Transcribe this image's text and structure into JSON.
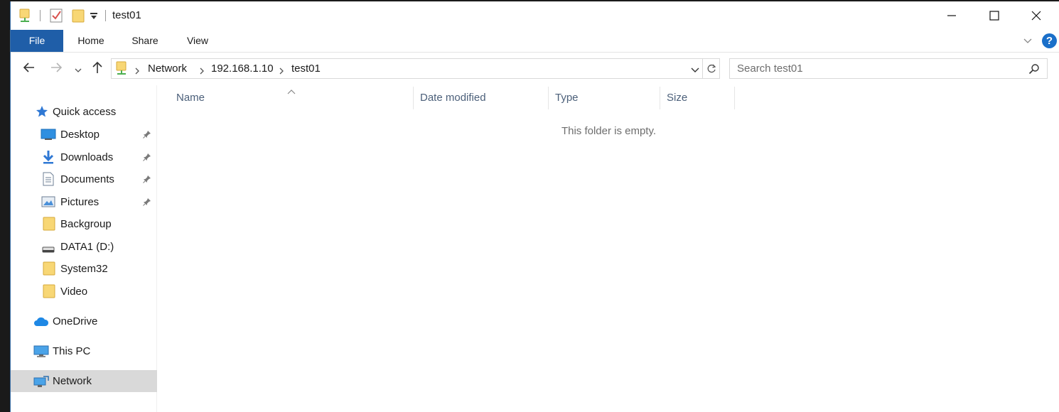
{
  "window": {
    "title": "test01"
  },
  "ribbon": {
    "tabs": [
      "File",
      "Home",
      "Share",
      "View"
    ],
    "help_label": "?"
  },
  "address_bar": {
    "crumbs": [
      "Network",
      "192.168.1.10",
      "test01"
    ]
  },
  "search": {
    "placeholder": "Search test01"
  },
  "sidebar": {
    "quick_access": "Quick access",
    "items": [
      {
        "label": "Desktop",
        "icon": "desktop-icon",
        "pinned": true
      },
      {
        "label": "Downloads",
        "icon": "downloads-icon",
        "pinned": true
      },
      {
        "label": "Documents",
        "icon": "documents-icon",
        "pinned": true
      },
      {
        "label": "Pictures",
        "icon": "pictures-icon",
        "pinned": true
      },
      {
        "label": "Backgroup",
        "icon": "folder-icon",
        "pinned": false
      },
      {
        "label": "DATA1 (D:)",
        "icon": "drive-icon",
        "pinned": false
      },
      {
        "label": "System32",
        "icon": "folder-icon",
        "pinned": false
      },
      {
        "label": "Video",
        "icon": "folder-icon",
        "pinned": false
      }
    ],
    "onedrive": "OneDrive",
    "this_pc": "This PC",
    "network": "Network"
  },
  "content": {
    "columns": [
      "Name",
      "Date modified",
      "Type",
      "Size"
    ],
    "empty_message": "This folder is empty."
  },
  "colors": {
    "accent": "#1f5ea8",
    "selected_bg": "#d9d9d9",
    "folder": "#f8d775",
    "header_text": "#4c607a"
  }
}
